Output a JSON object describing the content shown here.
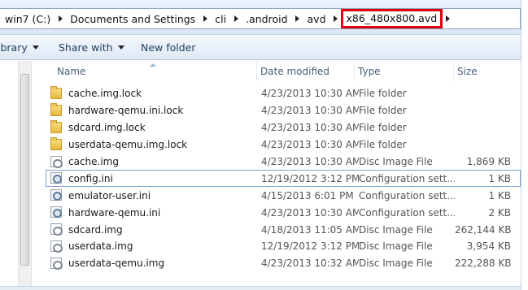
{
  "address": {
    "crumbs": [
      {
        "label": "win7 (C:)"
      },
      {
        "label": "Documents and Settings"
      },
      {
        "label": "cli"
      },
      {
        "label": ".android"
      },
      {
        "label": "avd"
      },
      {
        "label": "x86_480x800.avd"
      }
    ]
  },
  "toolbar": {
    "library_label": "ibrary",
    "share_label": "Share with",
    "new_folder_label": "New folder"
  },
  "columns": {
    "name": "Name",
    "date": "Date modified",
    "type": "Type",
    "size": "Size"
  },
  "files": [
    {
      "name": "cache.img.lock",
      "date": "4/23/2013 10:30 AM",
      "type": "File folder",
      "size": "",
      "icon": "folder-icon"
    },
    {
      "name": "hardware-qemu.ini.lock",
      "date": "4/23/2013 10:30 AM",
      "type": "File folder",
      "size": "",
      "icon": "folder-icon"
    },
    {
      "name": "sdcard.img.lock",
      "date": "4/23/2013 10:30 AM",
      "type": "File folder",
      "size": "",
      "icon": "folder-icon"
    },
    {
      "name": "userdata-qemu.img.lock",
      "date": "4/23/2013 10:30 AM",
      "type": "File folder",
      "size": "",
      "icon": "folder-icon"
    },
    {
      "name": "cache.img",
      "date": "4/23/2013 10:30 AM",
      "type": "Disc Image File",
      "size": "1,869 KB",
      "icon": "disc-image-icon"
    },
    {
      "name": "config.ini",
      "date": "12/19/2012 3:12 PM",
      "type": "Configuration sett...",
      "size": "1 KB",
      "icon": "config-file-icon"
    },
    {
      "name": "emulator-user.ini",
      "date": "4/15/2013 6:01 PM",
      "type": "Configuration sett...",
      "size": "1 KB",
      "icon": "config-file-icon"
    },
    {
      "name": "hardware-qemu.ini",
      "date": "4/23/2013 10:30 AM",
      "type": "Configuration sett...",
      "size": "2 KB",
      "icon": "config-file-icon"
    },
    {
      "name": "sdcard.img",
      "date": "4/18/2013 11:05 AM",
      "type": "Disc Image File",
      "size": "262,144 KB",
      "icon": "disc-image-icon"
    },
    {
      "name": "userdata.img",
      "date": "12/19/2012 3:12 PM",
      "type": "Disc Image File",
      "size": "3,954 KB",
      "icon": "disc-image-icon"
    },
    {
      "name": "userdata-qemu.img",
      "date": "4/23/2013 10:32 AM",
      "type": "Disc Image File",
      "size": "222,288 KB",
      "icon": "disc-image-icon"
    }
  ],
  "selected_index": 5,
  "colors": {
    "highlight_box": "#e00010",
    "toolbar_text": "#1e3a5c",
    "header_text": "#4c607a"
  }
}
